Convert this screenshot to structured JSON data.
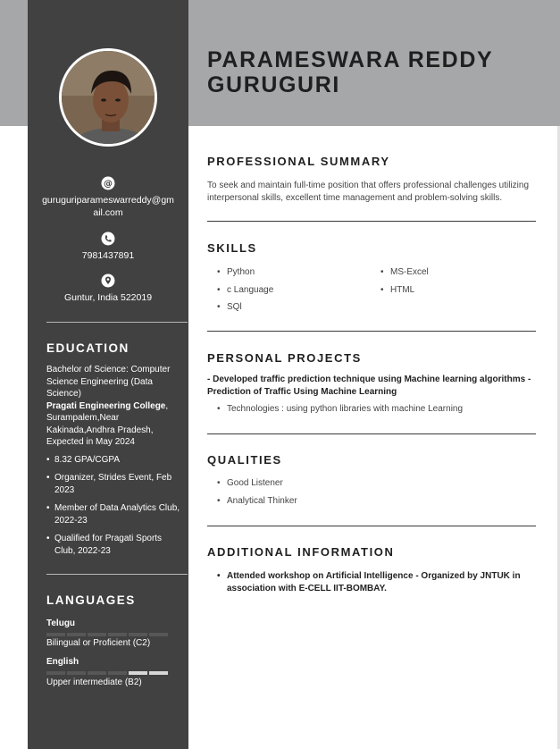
{
  "name": [
    "PARAMESWARA REDDY",
    "GURUGURI"
  ],
  "contact": {
    "email": "guruguriparameswarreddy@gmail.com",
    "phone": "7981437891",
    "location": "Guntur, India 522019"
  },
  "education": {
    "heading": "EDUCATION",
    "degree": "Bachelor of Science: Computer Science Engineering (Data Science)",
    "college": "Pragati Engineering College",
    "college_sep": ",",
    "location": "Surampalem,Near Kakinada,Andhra Pradesh,",
    "expected": "Expected in May 2024",
    "highlights": [
      "8.32 GPA/CGPA",
      "Organizer, Strides Event, Feb 2023",
      "Member of Data Analytics Club, 2022-23",
      "Qualified for Pragati Sports Club, 2022-23"
    ]
  },
  "languages": {
    "heading": "LANGUAGES",
    "items": [
      {
        "name": "Telugu",
        "level": "Bilingual or Proficient (C2)",
        "rating": 5,
        "max": 6
      },
      {
        "name": "English",
        "level": "Upper intermediate (B2)",
        "rating": 4,
        "max": 6
      }
    ]
  },
  "summary": {
    "heading": "PROFESSIONAL SUMMARY",
    "text": "To seek and maintain full-time position that offers professional challenges utilizing interpersonal skills, excellent time management and problem-solving skills."
  },
  "skills": {
    "heading": "SKILLS",
    "col1": [
      "Python",
      "c Language",
      "SQl"
    ],
    "col2": [
      "MS-Excel",
      "HTML"
    ]
  },
  "projects": {
    "heading": "PERSONAL PROJECTS",
    "title": "- Developed traffic prediction technique using Machine learning algorithms - Prediction of Traffic Using Machine Learning",
    "items": [
      "Technologies : using python libraries with machine Learning"
    ]
  },
  "qualities": {
    "heading": "QUALITIES",
    "items": [
      "Good Listener",
      "Analytical Thinker"
    ]
  },
  "additional": {
    "heading": "ADDITIONAL INFORMATION",
    "items": [
      "Attended workshop on Artificial Intelligence - Organized by JNTUK in association with E-CELL IIT-BOMBAY."
    ]
  },
  "colors": {
    "sidebar": "#414141",
    "header_band": "#a5a7a9",
    "rule": "#3a3a3a"
  }
}
